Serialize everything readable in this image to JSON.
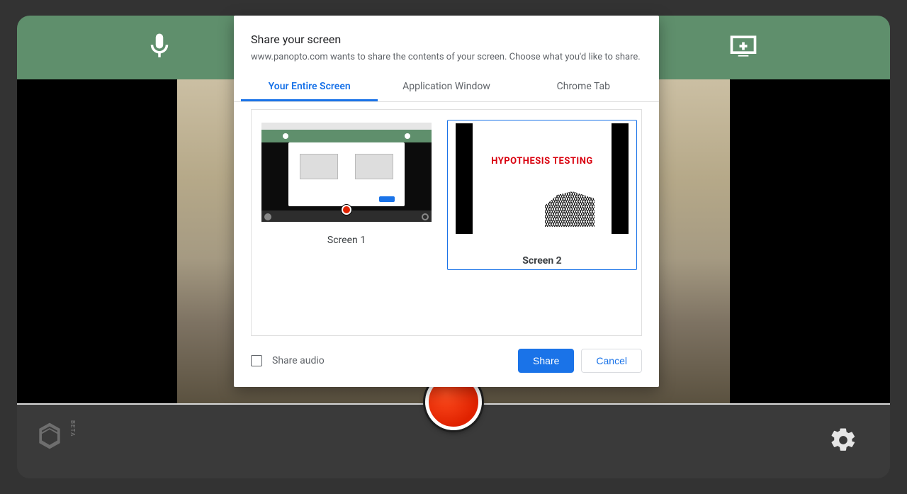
{
  "modal": {
    "title": "Share your screen",
    "description": "www.panopto.com wants to share the contents of your screen. Choose what you'd like to share.",
    "tabs": {
      "entire": "Your Entire Screen",
      "window": "Application Window",
      "tab": "Chrome Tab"
    },
    "screens": {
      "one": {
        "label": "Screen 1"
      },
      "two": {
        "label": "Screen 2",
        "slide_title": "HYPOTHESIS TESTING"
      }
    },
    "share_audio_label": "Share audio",
    "share_button": "Share",
    "cancel_button": "Cancel"
  },
  "app": {
    "beta_label": "BETA"
  }
}
